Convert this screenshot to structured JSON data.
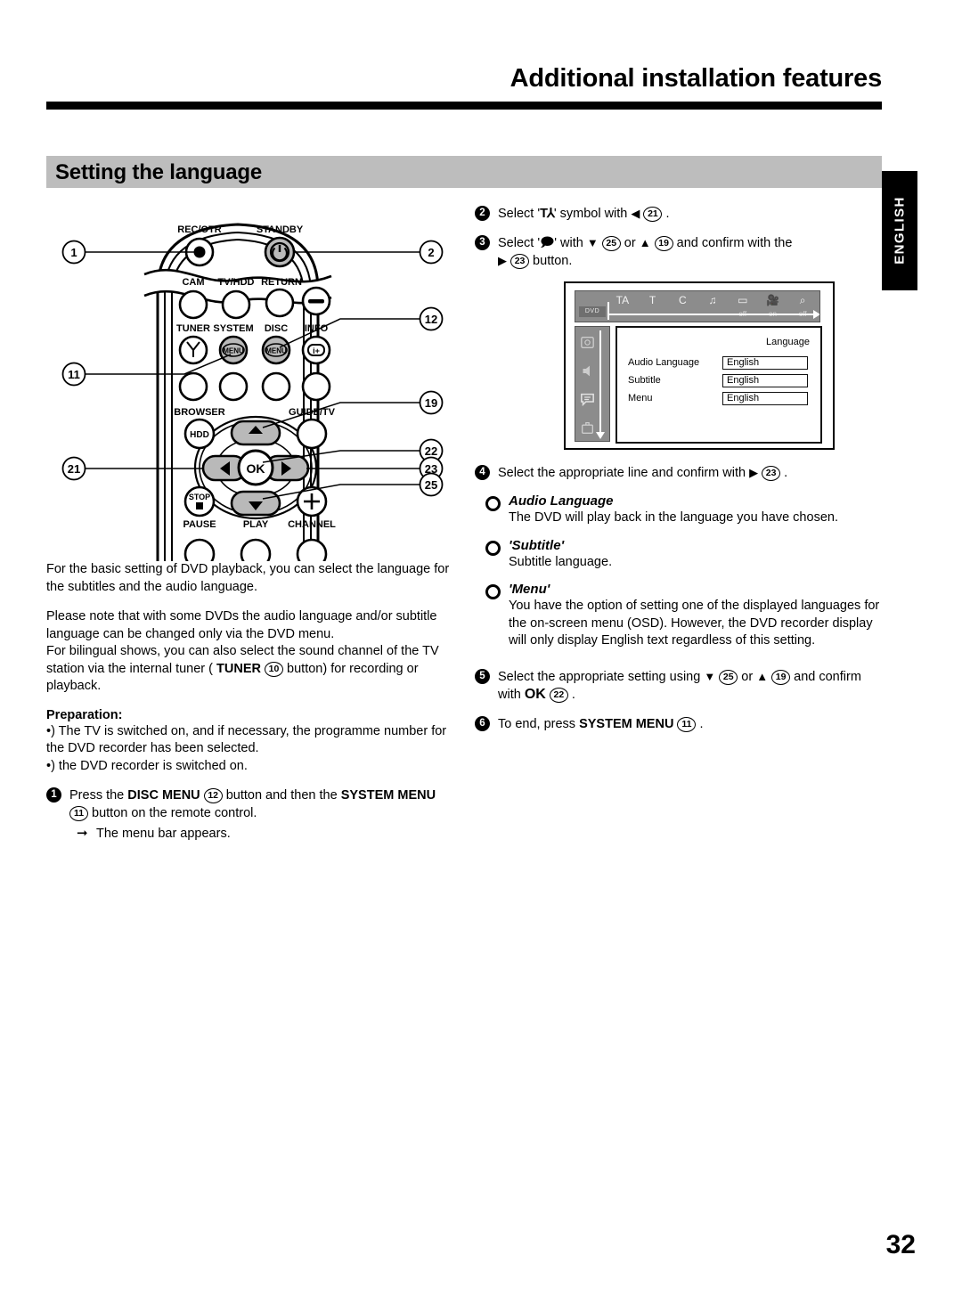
{
  "header": {
    "chapter_title": "Additional installation features",
    "section_title": "Setting the language",
    "side_tab": "ENGLISH"
  },
  "remote": {
    "caption_labels": {
      "rec_otr": "REC/OTR",
      "standby": "STANDBY",
      "cam": "CAM",
      "tv_hdd": "TV/HDD",
      "return": "RETURN",
      "tuner": "TUNER",
      "system": "SYSTEM",
      "disc": "DISC",
      "info": "INFO",
      "browser": "BROWSER",
      "guide_tv": "GUIDE/TV",
      "pause": "PAUSE",
      "play": "PLAY",
      "channel": "CHANNEL",
      "menu_btn": "MENU",
      "hdd": "HDD",
      "stop": "STOP",
      "ok": "OK",
      "info_glyph": "i+"
    },
    "callouts_left": [
      "1",
      "11",
      "21"
    ],
    "callouts_right": [
      "2",
      "12",
      "19",
      "22",
      "23",
      "25"
    ]
  },
  "left_column": {
    "intro1": "For the basic setting of DVD playback, you can select the language for the subtitles and the audio language.",
    "intro2": "Please note that with some DVDs the audio language and/or subtitle language can be changed only via the DVD menu.",
    "intro3_a": "For bilingual shows, you can also select the sound channel of the TV station via the internal tuner ( ",
    "intro3_tuner": "TUNER",
    "intro3_ref": "10",
    "intro3_b": " button) for recording or playback.",
    "preparation_heading": "Preparation:",
    "prep_bullet1": "•) The TV is switched on, and if necessary, the programme number for the DVD recorder has been selected.",
    "prep_bullet2": "•) the DVD recorder is switched on.",
    "step1": {
      "num": "1",
      "a": "Press the ",
      "disc_menu": "DISC MENU",
      "ref12": "12",
      "b": " button and then the ",
      "system_menu": "SYSTEM MENU",
      "ref11": "11",
      "c": " button on the remote control.",
      "arrow_note": "The menu bar appears."
    }
  },
  "right_column": {
    "step2": {
      "num": "2",
      "a": "Select '",
      "symbol": "TA",
      "b": "' symbol with ",
      "dir": "◀",
      "ref": "21",
      "c": "."
    },
    "step3": {
      "num": "3",
      "a": "Select '",
      "symbol": "bubble",
      "b": "' with ",
      "dir1": "▼",
      "ref1": "25",
      "c": " or ",
      "dir2": "▲",
      "ref2": "19",
      "d": " and confirm with the ",
      "dir3": "▶",
      "ref3": "23",
      "e": " button."
    },
    "step4": {
      "num": "4",
      "a": "Select the appropriate line and confirm with ",
      "dir": "▶",
      "ref": "23",
      "b": "."
    },
    "options": [
      {
        "title": "Audio Language",
        "body": "The DVD will play back in the language you have chosen."
      },
      {
        "title": "'Subtitle'",
        "body": "Subtitle language."
      },
      {
        "title": "'Menu'",
        "body": "You have the option of setting one of the displayed languages for the on-screen menu (OSD). However, the DVD recorder display will only display English text regardless of this setting."
      }
    ],
    "step5": {
      "num": "5",
      "a": "Select the appropriate setting using ",
      "dir1": "▼",
      "ref1": "25",
      "b": " or ",
      "dir2": "▲",
      "ref2": "19",
      "c": " and confirm with ",
      "ok": "OK",
      "ref3": "22",
      "d": "."
    },
    "step6": {
      "num": "6",
      "a": "To end, press ",
      "system_menu": "SYSTEM MENU",
      "ref": "11",
      "b": "."
    }
  },
  "osd": {
    "dvd_tag": "DVD",
    "menubar_items": [
      "TA",
      "T",
      "C",
      "♫",
      "▭",
      "🎥",
      "⌕"
    ],
    "menubar_states": [
      "",
      "",
      "",
      "",
      "off",
      "on",
      "off"
    ],
    "panel_title": "Language",
    "rows": [
      {
        "label": "Audio Language",
        "value": "English"
      },
      {
        "label": "Subtitle",
        "value": "English"
      },
      {
        "label": "Menu",
        "value": "English"
      }
    ]
  },
  "footer": {
    "page_number": "32"
  }
}
